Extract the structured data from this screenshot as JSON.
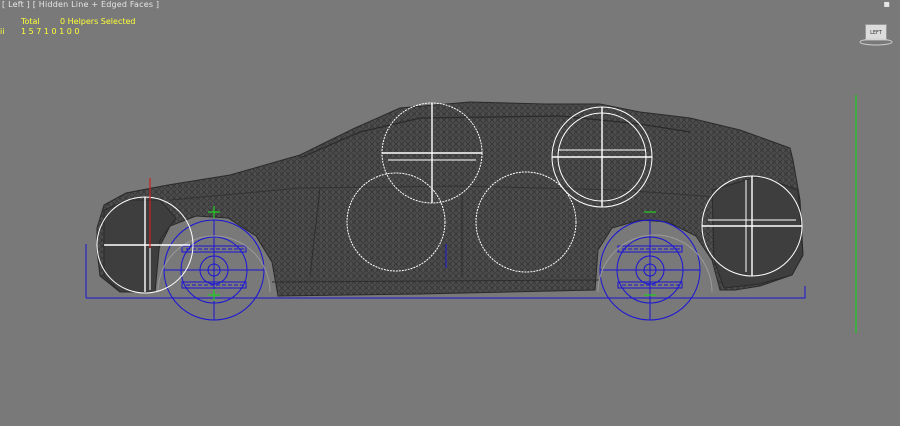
{
  "viewport": {
    "label": "[ Left ] [ Hidden Line + Edged Faces ]",
    "stats": {
      "total_label": "Total",
      "helpers_label": "0 Helpers Selected",
      "row2_prefix": "ii",
      "row2_value": "1 5 7 1 0 1 0 0"
    },
    "viewcube_label": "LEFT",
    "close_glyph": "▪"
  },
  "colors": {
    "background": "#797979",
    "mesh": "#3a3a3a",
    "helpers": "#ffffff",
    "skeleton": "#1a14d6",
    "axis_green": "#22cc22",
    "axis_red": "#cc2222",
    "stats_text": "#ffff38"
  }
}
